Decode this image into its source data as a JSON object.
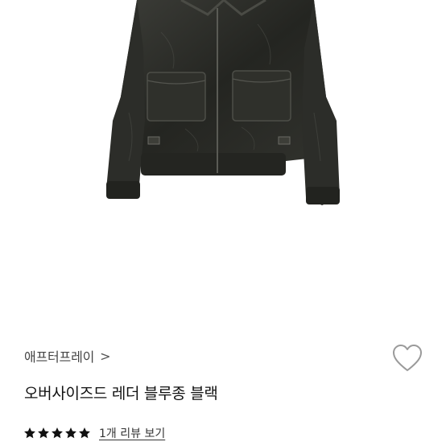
{
  "product": {
    "image_alt_icon": "leather-jacket-image",
    "brand": "애프터프레이",
    "brand_chevron": ">",
    "title": "오버사이즈드 레더 블루종 블랙",
    "rating": 5,
    "rating_max": 5,
    "review_link": "1개 리뷰 보기",
    "wishlist_icon": "heart-icon"
  },
  "colors": {
    "jacket": "#2a2b27",
    "star": "#111111",
    "heart_stroke": "#9a9a9a"
  }
}
